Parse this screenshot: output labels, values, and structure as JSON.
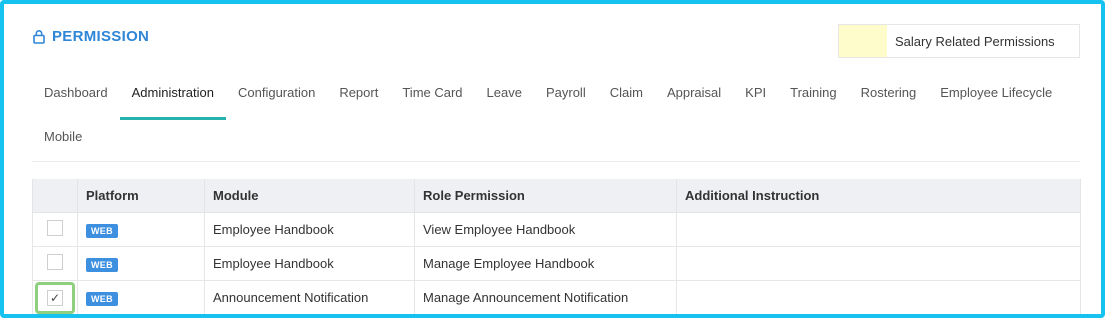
{
  "header": {
    "title": "PERMISSION",
    "icon": "lock-icon",
    "color": "#2f86d6"
  },
  "legend": {
    "label": "Salary Related Permissions",
    "swatch_color": "#fffccc"
  },
  "tabs": [
    {
      "label": "Dashboard",
      "active": false
    },
    {
      "label": "Administration",
      "active": true
    },
    {
      "label": "Configuration",
      "active": false
    },
    {
      "label": "Report",
      "active": false
    },
    {
      "label": "Time Card",
      "active": false
    },
    {
      "label": "Leave",
      "active": false
    },
    {
      "label": "Payroll",
      "active": false
    },
    {
      "label": "Claim",
      "active": false
    },
    {
      "label": "Appraisal",
      "active": false
    },
    {
      "label": "KPI",
      "active": false
    },
    {
      "label": "Training",
      "active": false
    },
    {
      "label": "Rostering",
      "active": false
    },
    {
      "label": "Employee Lifecycle",
      "active": false
    },
    {
      "label": "Mobile",
      "active": false
    }
  ],
  "table": {
    "headers": [
      "",
      "Platform",
      "Module",
      "Role Permission",
      "Additional Instruction"
    ],
    "rows": [
      {
        "checked": false,
        "platform": "WEB",
        "module": "Employee Handbook",
        "permission": "View Employee Handbook",
        "instruction": ""
      },
      {
        "checked": false,
        "platform": "WEB",
        "module": "Employee Handbook",
        "permission": "Manage Employee Handbook",
        "instruction": ""
      },
      {
        "checked": true,
        "platform": "WEB",
        "module": "Announcement Notification",
        "permission": "Manage Announcement Notification",
        "instruction": ""
      }
    ]
  },
  "colors": {
    "accent_tab": "#26b3ad",
    "frame": "#16c2f0",
    "badge": "#3d8fe0",
    "highlight": "#8fd07e"
  }
}
